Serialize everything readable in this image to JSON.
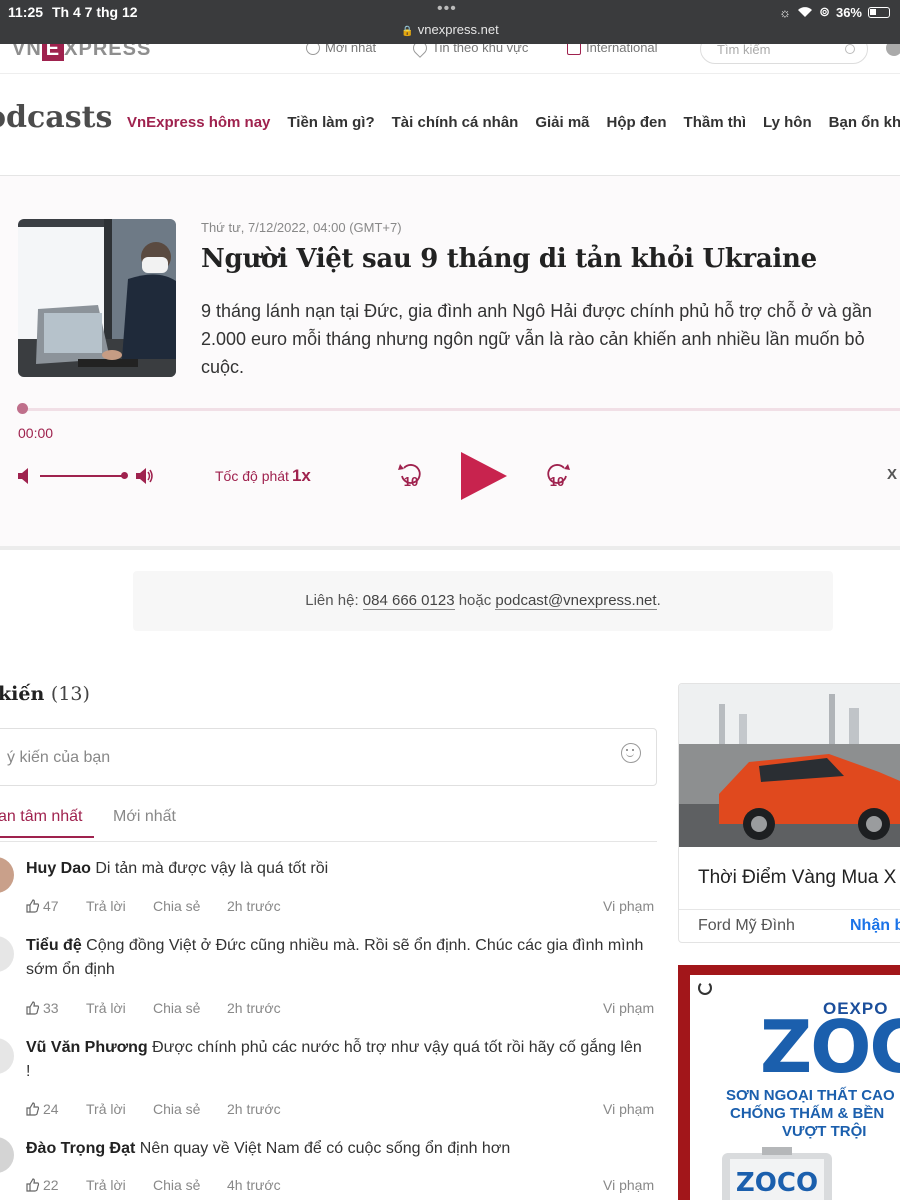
{
  "status_bar": {
    "time": "11:25",
    "date": "Th 4 7 thg 12",
    "url": "vnexpress.net",
    "battery": "36%"
  },
  "site_header": {
    "logo_prefix": "VN",
    "logo_e": "E",
    "logo_suffix": "XPRESS",
    "links": [
      "Mới nhất",
      "Tin theo khu vực",
      "International"
    ],
    "search_placeholder": "Tìm kiếm"
  },
  "category": {
    "title": "odcasts",
    "items": [
      "VnExpress hôm nay",
      "Tiền làm gì?",
      "Tài chính cá nhân",
      "Giải mã",
      "Hộp đen",
      "Thầm thì",
      "Ly hôn",
      "Bạn ổn khôn"
    ]
  },
  "player": {
    "date": "Thứ tư, 7/12/2022, 04:00 (GMT+7)",
    "title": "Người Việt sau 9 tháng di tản khỏi Ukraine",
    "description": "9 tháng lánh nạn tại Đức, gia đình anh Ngô Hải được chính phủ hỗ trợ chỗ ở và gần 2.000 euro mỗi tháng nhưng ngôn ngữ vẫn là rào cản khiến anh nhiều lần muốn bỏ cuộc.",
    "current_time": "00:00",
    "progress": 0,
    "volume": 1.0,
    "speed_label": "Tốc độ phát",
    "speed_value": "1x",
    "skip_back": "10",
    "skip_forward": "10",
    "close_label": "X",
    "accent_color": "#9f224e",
    "play_color": "#c8234e"
  },
  "contact": {
    "prefix": "Liên hệ: ",
    "phone": "084 666 0123",
    "middle": " hoặc ",
    "email": "podcast@vnexpress.net",
    "suffix": "."
  },
  "comments": {
    "heading": "kiến",
    "count": "(13)",
    "input_placeholder": "ý kiến của bạn",
    "tabs": [
      "an tâm nhất",
      "Mới nhất"
    ],
    "items": [
      {
        "author": "Huy Dao",
        "text": " Di tản mà được vậy là quá tốt rồi",
        "likes": "47",
        "reply": "Trả lời",
        "share": "Chia sẻ",
        "time": "2h trước",
        "report": "Vi phạm"
      },
      {
        "author": "Tiểu đệ",
        "text": " Cộng đồng Việt ở Đức cũng nhiều mà. Rồi sẽ ổn định. Chúc các gia đình mình sớm ổn định",
        "likes": "33",
        "reply": "Trả lời",
        "share": "Chia sẻ",
        "time": "2h trước",
        "report": "Vi phạm"
      },
      {
        "author": "Vũ Văn Phương",
        "text": " Được chính phủ các nước hỗ trợ như vậy quá tốt rồi hãy cố gắng lên !",
        "likes": "24",
        "reply": "Trả lời",
        "share": "Chia sẻ",
        "time": "2h trước",
        "report": "Vi phạm"
      },
      {
        "author": "Đào Trọng Đạt",
        "text": " Nên quay về Việt Nam để có cuộc sống ổn định hơn",
        "likes": "22",
        "reply": "Trả lời",
        "share": "Chia sẻ",
        "time": "4h trước",
        "report": "Vi phạm"
      }
    ]
  },
  "ads": {
    "car": {
      "title": "Thời Điểm Vàng Mua X",
      "brand": "Ford Mỹ Đình",
      "cta": "Nhận b"
    },
    "paint": {
      "brand": "OEXPO",
      "name": "ZOCO",
      "line1": "SƠN NGOẠI THẤT CAO",
      "line2": "CHỐNG THẤM & BỀN",
      "line3": "VƯỢT TRỘI",
      "can_label": "ZOCO"
    }
  }
}
